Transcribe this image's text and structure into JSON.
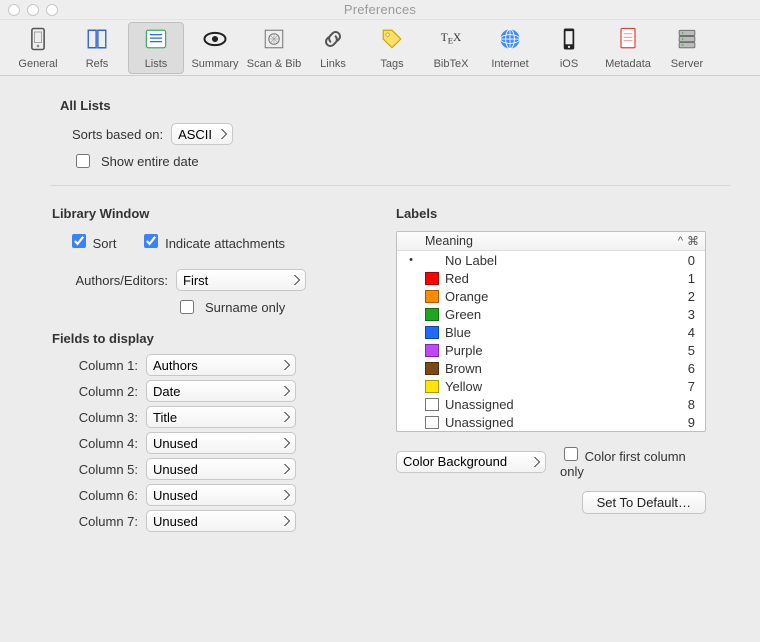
{
  "window": {
    "title": "Preferences"
  },
  "toolbar": {
    "items": [
      {
        "label": "General",
        "icon": "general-icon"
      },
      {
        "label": "Refs",
        "icon": "refs-icon"
      },
      {
        "label": "Lists",
        "icon": "lists-icon",
        "selected": true
      },
      {
        "label": "Summary",
        "icon": "summary-icon"
      },
      {
        "label": "Scan & Bib",
        "icon": "scan-icon"
      },
      {
        "label": "Links",
        "icon": "links-icon"
      },
      {
        "label": "Tags",
        "icon": "tags-icon"
      },
      {
        "label": "BibTeX",
        "icon": "bibtex-icon"
      },
      {
        "label": "Internet",
        "icon": "internet-icon"
      },
      {
        "label": "iOS",
        "icon": "ios-icon"
      },
      {
        "label": "Metadata",
        "icon": "metadata-icon"
      },
      {
        "label": "Server",
        "icon": "server-icon"
      }
    ]
  },
  "all_lists": {
    "title": "All Lists",
    "sorts_label": "Sorts based on:",
    "sorts_value": "ASCII",
    "show_entire_date_label": "Show entire date",
    "show_entire_date_checked": false
  },
  "library_window": {
    "title": "Library Window",
    "sort_label": "Sort",
    "sort_checked": true,
    "indicate_label": "Indicate attachments",
    "indicate_checked": true,
    "authors_label": "Authors/Editors:",
    "authors_value": "First",
    "surname_only_label": "Surname only",
    "surname_only_checked": false
  },
  "fields": {
    "title": "Fields to display",
    "columns": [
      {
        "label": "Column 1:",
        "value": "Authors"
      },
      {
        "label": "Column 2:",
        "value": "Date"
      },
      {
        "label": "Column 3:",
        "value": "Title"
      },
      {
        "label": "Column 4:",
        "value": "Unused"
      },
      {
        "label": "Column 5:",
        "value": "Unused"
      },
      {
        "label": "Column 6:",
        "value": "Unused"
      },
      {
        "label": "Column 7:",
        "value": "Unused"
      }
    ]
  },
  "labels": {
    "title": "Labels",
    "columns": {
      "meaning": "Meaning"
    },
    "rows": [
      {
        "name": "No Label",
        "color": null,
        "shortcut": "0",
        "bullet": true
      },
      {
        "name": "Red",
        "color": "#ff0000",
        "shortcut": "1"
      },
      {
        "name": "Orange",
        "color": "#ff8c00",
        "shortcut": "2"
      },
      {
        "name": "Green",
        "color": "#1fa51f",
        "shortcut": "3"
      },
      {
        "name": "Blue",
        "color": "#1e6bff",
        "shortcut": "4"
      },
      {
        "name": "Purple",
        "color": "#c245ff",
        "shortcut": "5"
      },
      {
        "name": "Brown",
        "color": "#7a4a16",
        "shortcut": "6"
      },
      {
        "name": "Yellow",
        "color": "#ffe600",
        "shortcut": "7"
      },
      {
        "name": "Unassigned",
        "color": "",
        "shortcut": "8"
      },
      {
        "name": "Unassigned",
        "color": "",
        "shortcut": "9"
      }
    ],
    "style_select_value": "Color Background",
    "color_first_col_label": "Color first column only",
    "color_first_col_checked": false,
    "default_button": "Set To Default…"
  }
}
